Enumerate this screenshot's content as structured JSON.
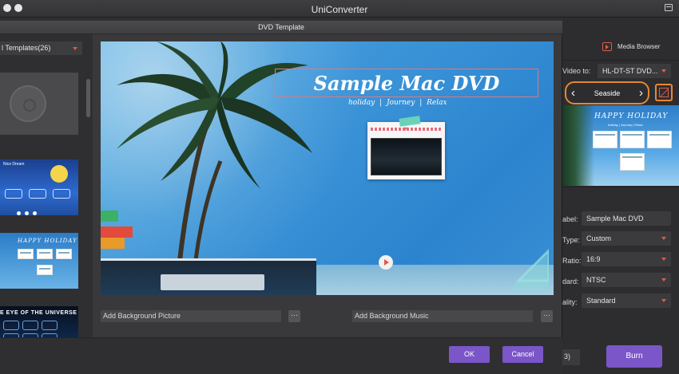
{
  "app": {
    "title": "UniConverter"
  },
  "dialog": {
    "title": "DVD Template",
    "template_select": "l Templates(26)",
    "templates": [
      {
        "name": "blank-disc"
      },
      {
        "name": "starry-night",
        "text": "Nice Dream"
      },
      {
        "name": "happy-holiday",
        "text": "HAPPY HOLIDAY"
      },
      {
        "name": "eye-of-universe",
        "text": "E EYE OF THE UNIVERSE"
      }
    ],
    "preview": {
      "title": "Sample Mac DVD",
      "links": [
        "holiday",
        "|",
        "Journey",
        "|",
        "Relax"
      ]
    },
    "background_picture_label": "Add Background Picture",
    "background_music_label": "Add Background Music",
    "more_label": "···",
    "ok_label": "OK",
    "cancel_label": "Cancel"
  },
  "right_panel": {
    "media_browser": "Media Browser",
    "burn_to_label": "Video to:",
    "burn_to_value": "HL-DT-ST DVD...",
    "template_name": "Seaside",
    "thumb_title": "HAPPY HOLIDAY",
    "thumb_sub": "holiday | Journey | Relax",
    "fields": [
      {
        "label": "abel:",
        "value": "Sample Mac DVD"
      },
      {
        "label": "Type:",
        "value": "Custom"
      },
      {
        "label": "Ratio:",
        "value": "16:9"
      },
      {
        "label": "dard:",
        "value": "NTSC"
      },
      {
        "label": "ality:",
        "value": "Standard"
      }
    ],
    "output_select": "3)",
    "burn_label": "Burn"
  },
  "colors": {
    "accent": "#7b56c9",
    "highlight": "#e8872f",
    "caret": "#e05a4f"
  }
}
